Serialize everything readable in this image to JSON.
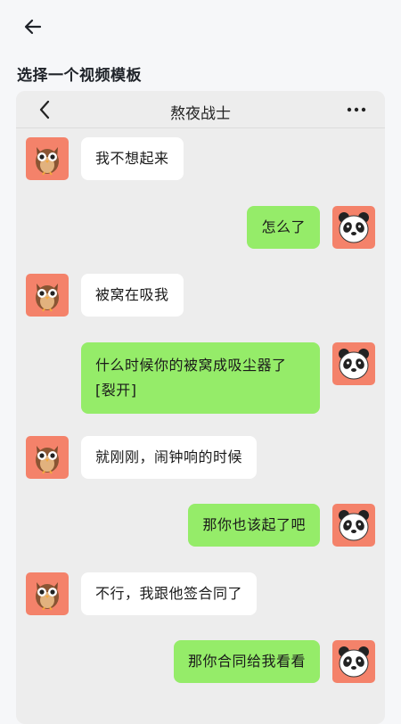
{
  "header": {
    "back_icon": "arrow-left-icon"
  },
  "page": {
    "title": "选择一个视频模板"
  },
  "chat": {
    "title": "熬夜战士",
    "back_icon": "chevron-left-icon",
    "more_icon": "more-dots-icon",
    "messages": [
      {
        "side": "left",
        "avatar": "owl-avatar",
        "text": "我不想起来"
      },
      {
        "side": "right",
        "avatar": "panda-avatar",
        "text": "怎么了"
      },
      {
        "side": "left",
        "avatar": "owl-avatar",
        "text": "被窝在吸我"
      },
      {
        "side": "right",
        "avatar": "panda-avatar",
        "text": "什么时候你的被窝成吸尘器了[裂开]"
      },
      {
        "side": "left",
        "avatar": "owl-avatar",
        "text": "就刚刚，闹钟响的时候"
      },
      {
        "side": "right",
        "avatar": "panda-avatar",
        "text": "那你也该起了吧"
      },
      {
        "side": "left",
        "avatar": "owl-avatar",
        "text": "不行，我跟他签合同了"
      },
      {
        "side": "right",
        "avatar": "panda-avatar",
        "text": "那你合同给我看看"
      }
    ]
  },
  "colors": {
    "bubble_out": "#95ec69",
    "bubble_in": "#ffffff",
    "avatar_bg": "#f4826a",
    "chat_bg": "#ededed"
  }
}
